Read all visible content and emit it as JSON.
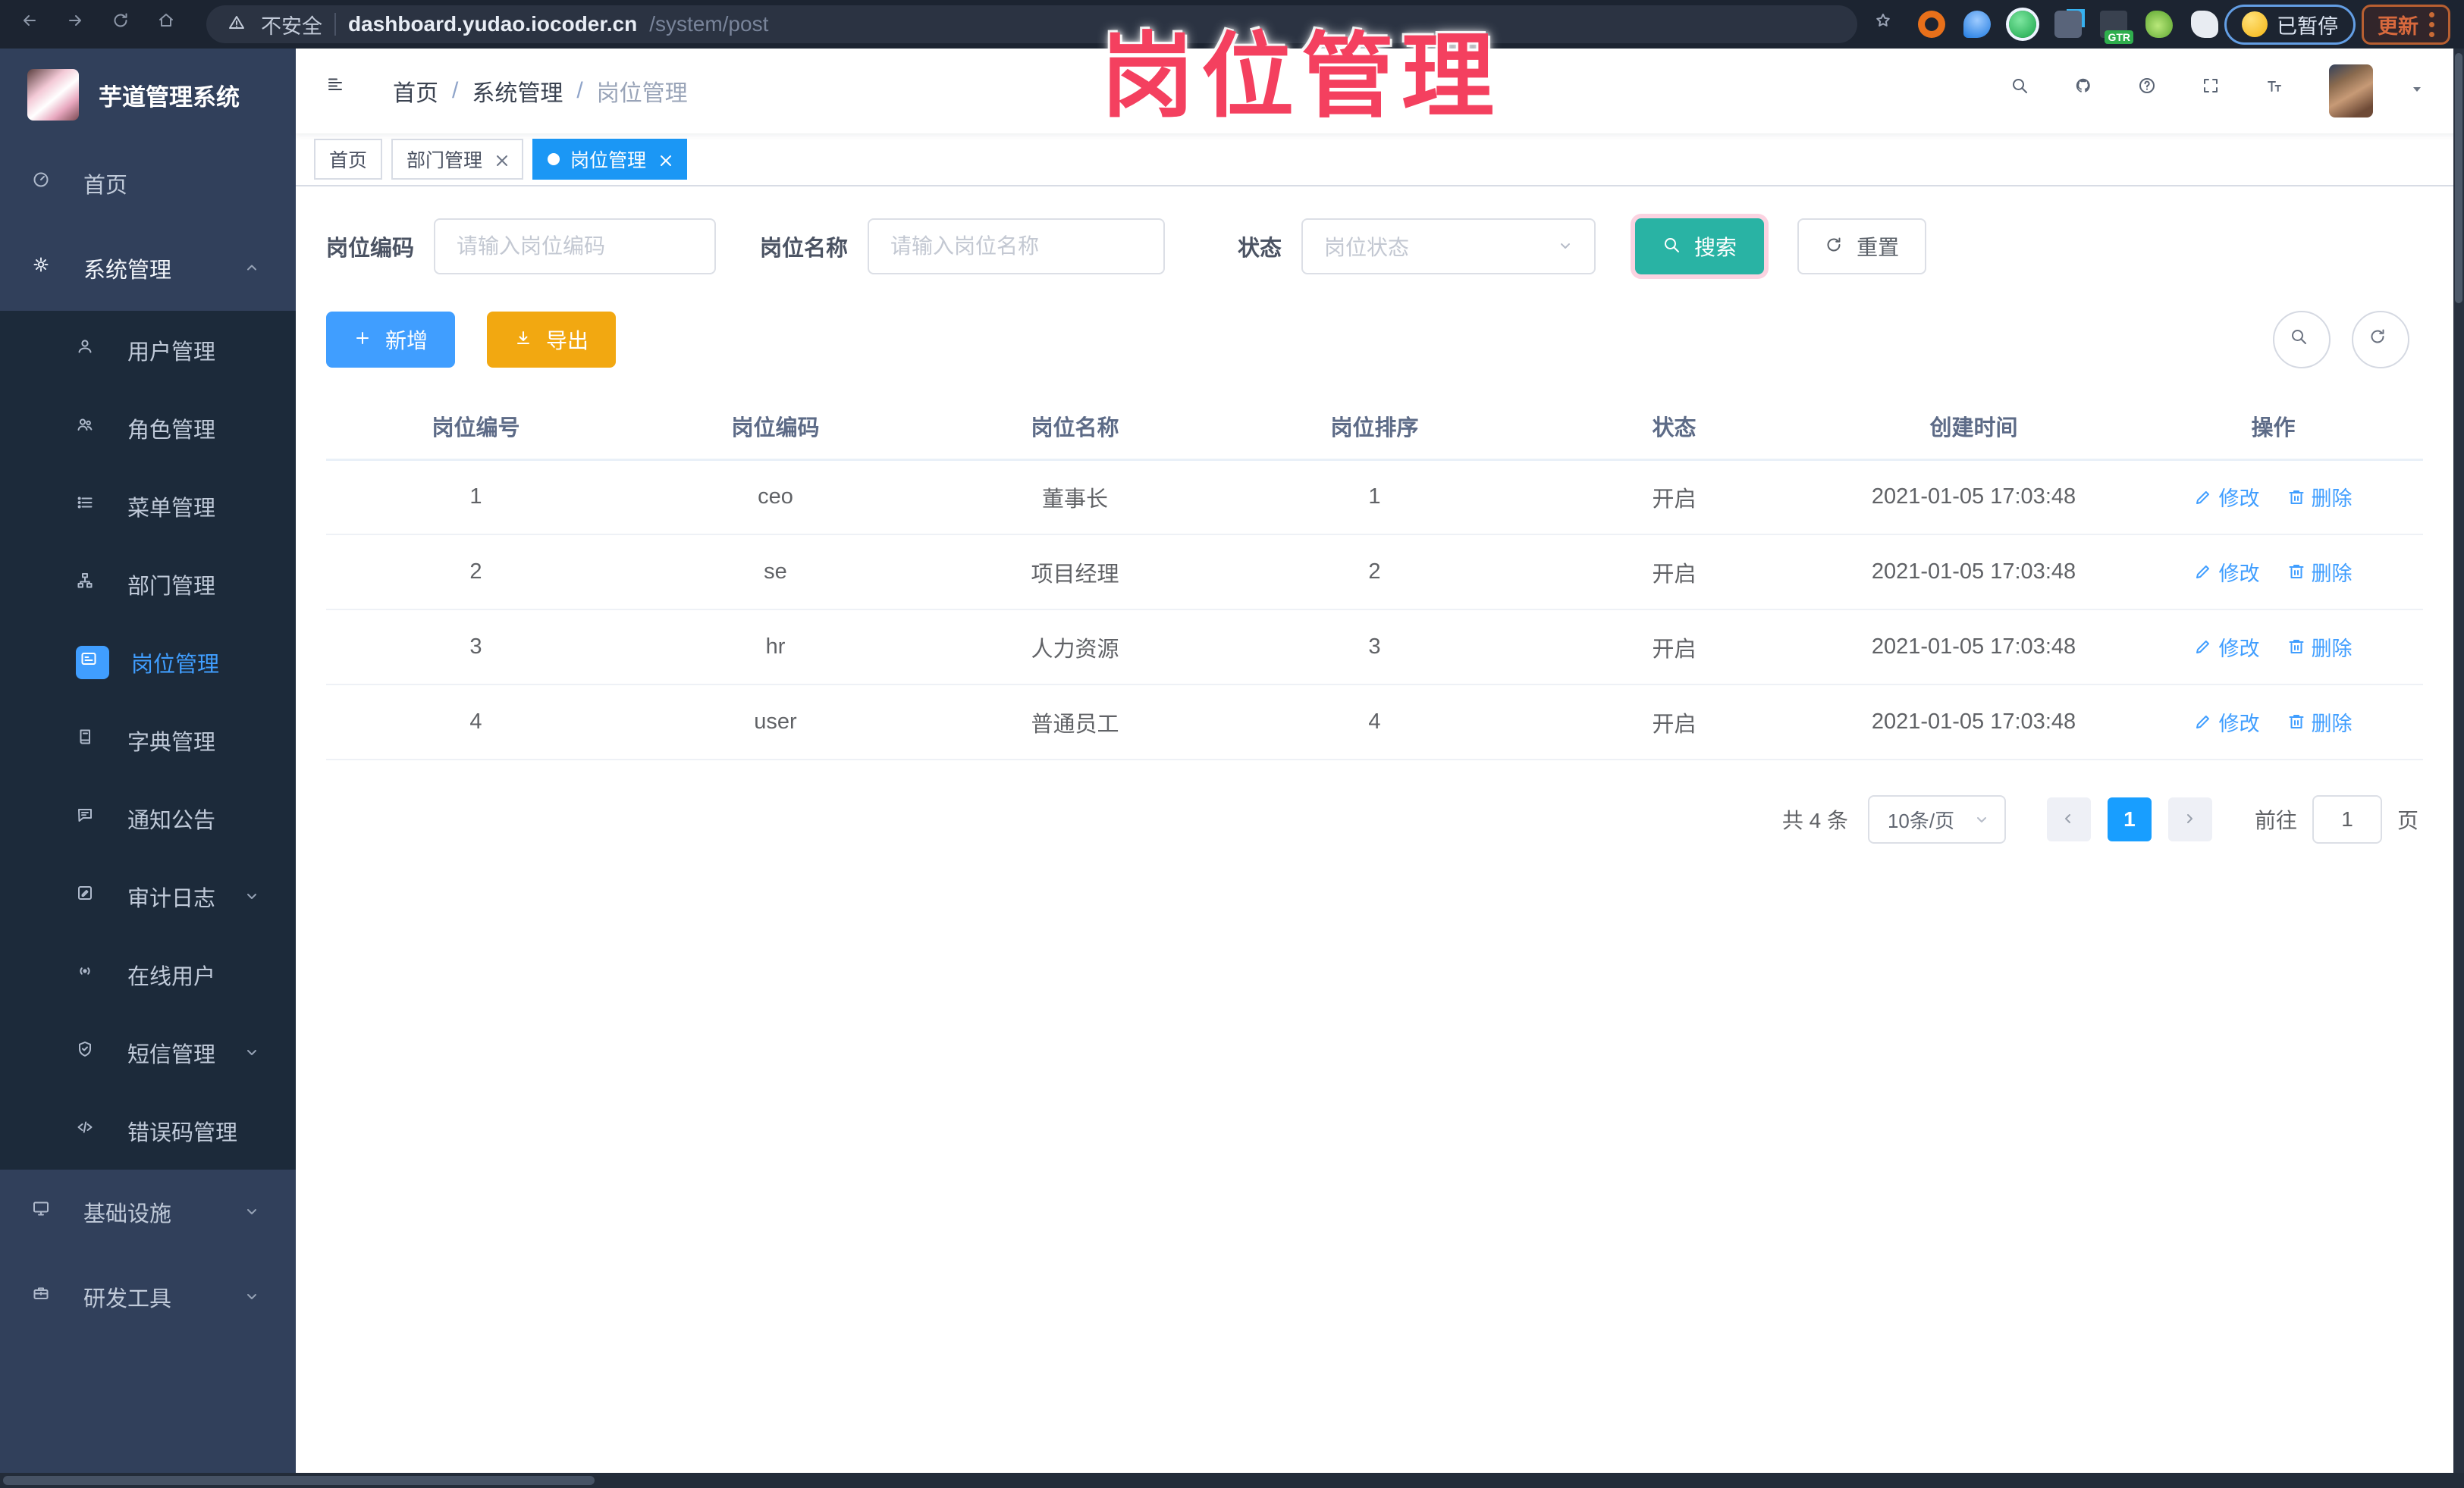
{
  "browser": {
    "security_label": "不安全",
    "url_host": "dashboard.yudao.iocoder.cn",
    "url_path": "/system/post",
    "paused_badge": "已暂停",
    "update_button": "更新",
    "gtr_badge": "GTR"
  },
  "watermark": "岗位管理",
  "sidebar": {
    "app_title": "芋道管理系统",
    "items": [
      {
        "label": "首页"
      },
      {
        "label": "系统管理"
      },
      {
        "label": "用户管理"
      },
      {
        "label": "角色管理"
      },
      {
        "label": "菜单管理"
      },
      {
        "label": "部门管理"
      },
      {
        "label": "岗位管理"
      },
      {
        "label": "字典管理"
      },
      {
        "label": "通知公告"
      },
      {
        "label": "审计日志"
      },
      {
        "label": "在线用户"
      },
      {
        "label": "短信管理"
      },
      {
        "label": "错误码管理"
      },
      {
        "label": "基础设施"
      },
      {
        "label": "研发工具"
      }
    ]
  },
  "header": {
    "breadcrumb": {
      "0": "首页",
      "1": "系统管理",
      "2": "岗位管理"
    },
    "separator": "/"
  },
  "tabs": [
    {
      "label": "首页"
    },
    {
      "label": "部门管理"
    },
    {
      "label": "岗位管理"
    }
  ],
  "filters": {
    "post_code_label": "岗位编码",
    "post_code_placeholder": "请输入岗位编码",
    "post_name_label": "岗位名称",
    "post_name_placeholder": "请输入岗位名称",
    "status_label": "状态",
    "status_placeholder": "岗位状态",
    "search_label": "搜索",
    "reset_label": "重置"
  },
  "toolbar": {
    "add_label": "新增",
    "export_label": "导出"
  },
  "table": {
    "columns": {
      "0": "岗位编号",
      "1": "岗位编码",
      "2": "岗位名称",
      "3": "岗位排序",
      "4": "状态",
      "5": "创建时间",
      "6": "操作"
    },
    "edit_label": "修改",
    "delete_label": "删除",
    "rows": [
      {
        "id": "1",
        "code": "ceo",
        "name": "董事长",
        "sort": "1",
        "status": "开启",
        "created": "2021-01-05 17:03:48"
      },
      {
        "id": "2",
        "code": "se",
        "name": "项目经理",
        "sort": "2",
        "status": "开启",
        "created": "2021-01-05 17:03:48"
      },
      {
        "id": "3",
        "code": "hr",
        "name": "人力资源",
        "sort": "3",
        "status": "开启",
        "created": "2021-01-05 17:03:48"
      },
      {
        "id": "4",
        "code": "user",
        "name": "普通员工",
        "sort": "4",
        "status": "开启",
        "created": "2021-01-05 17:03:48"
      }
    ]
  },
  "pagination": {
    "total_text": "共 4 条",
    "page_size": "10条/页",
    "current_page": "1",
    "goto_label": "前往",
    "goto_value": "1",
    "page_unit": "页"
  },
  "colors": {
    "accent_blue": "#409eff",
    "active_tab_blue": "#1b97f5",
    "search_teal": "#29b3a4",
    "export_orange": "#f2a811",
    "watermark_pink": "#f4405f",
    "sidebar_bg": "#31405b",
    "submenu_bg": "#1c2a3a",
    "browser_bar_bg": "#1c2431"
  }
}
